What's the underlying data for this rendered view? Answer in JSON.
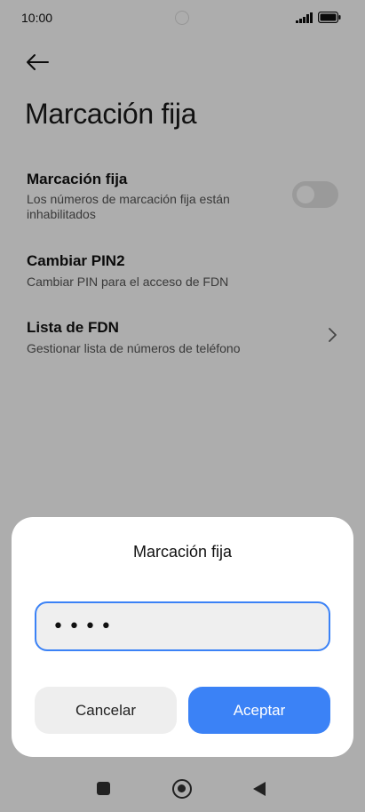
{
  "status_bar": {
    "time": "10:00",
    "icons": [
      "signal-icon",
      "battery-icon"
    ]
  },
  "header": {
    "back_icon": "arrow-left-icon",
    "title": "Marcación fija"
  },
  "settings": {
    "fixed_dialing": {
      "title": "Marcación fija",
      "subtitle": "Los números de marcación fija están inhabilitados",
      "toggle_on": false
    },
    "change_pin2": {
      "title": "Cambiar PIN2",
      "subtitle": "Cambiar PIN para el acceso de FDN"
    },
    "fdn_list": {
      "title": "Lista de FDN",
      "subtitle": "Gestionar lista de números de teléfono",
      "icon": "chevron-right-icon"
    }
  },
  "dialog": {
    "title": "Marcación fija",
    "pin_value": "••••",
    "cancel_label": "Cancelar",
    "ok_label": "Aceptar"
  },
  "nav_bar": {
    "icons": [
      "recents-icon",
      "home-icon",
      "back-icon"
    ]
  },
  "colors": {
    "accent": "#3b82f6",
    "scrim": "rgba(0,0,0,0.32)"
  }
}
